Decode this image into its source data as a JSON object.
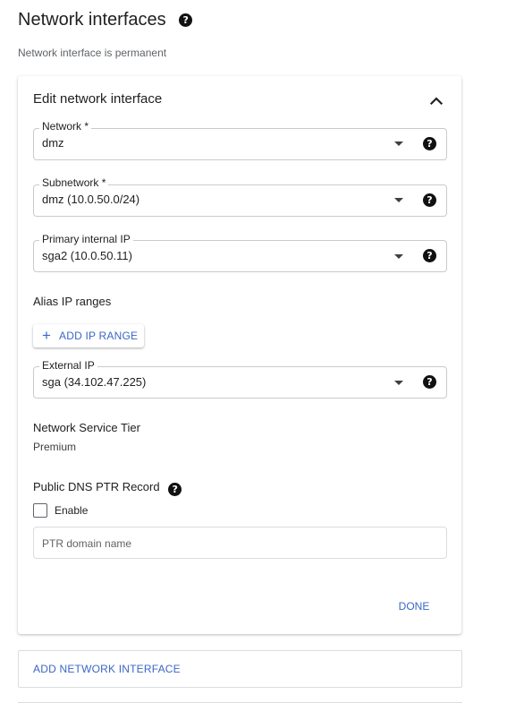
{
  "header": {
    "title": "Network interfaces",
    "subtitle": "Network interface is permanent"
  },
  "card": {
    "title": "Edit network interface",
    "network": {
      "label": "Network *",
      "value": "dmz"
    },
    "subnetwork": {
      "label": "Subnetwork *",
      "value": "dmz (10.0.50.0/24)"
    },
    "primary_ip": {
      "label": "Primary internal IP",
      "value": "sga2 (10.0.50.11)"
    },
    "alias": {
      "label": "Alias IP ranges",
      "button": "ADD IP RANGE"
    },
    "external_ip": {
      "label": "External IP",
      "value": "sga (34.102.47.225)"
    },
    "tier": {
      "label": "Network Service Tier",
      "value": "Premium"
    },
    "dns": {
      "label": "Public DNS PTR Record",
      "enable_label": "Enable",
      "enabled": false,
      "ptr_placeholder": "PTR domain name"
    },
    "done_label": "DONE"
  },
  "footer": {
    "add_interface_label": "ADD NETWORK INTERFACE"
  },
  "colors": {
    "accent": "#3c67c6",
    "text": "#202124",
    "secondary_text": "#5f6368",
    "border": "#c8cacd"
  },
  "icons": {
    "help": "help-circle-icon",
    "collapse": "chevron-up-icon",
    "dropdown": "caret-down-icon",
    "add": "plus-icon"
  }
}
